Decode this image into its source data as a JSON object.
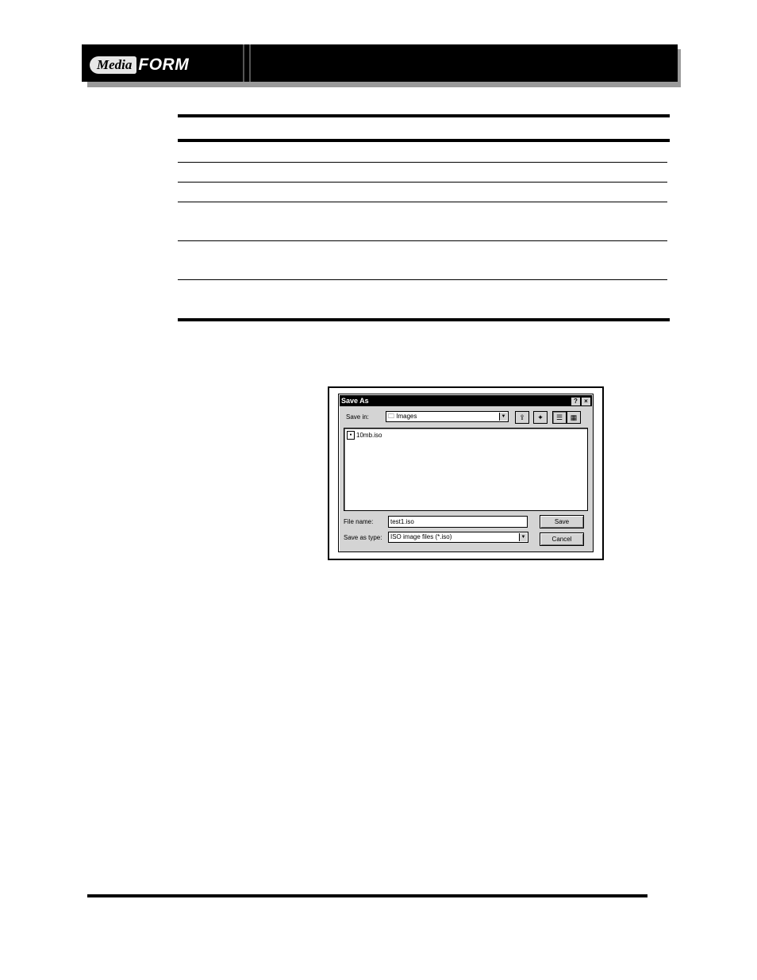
{
  "header": {
    "logo_prefix": "Media",
    "logo_word": "FORM"
  },
  "dialog": {
    "title": "Save As",
    "help_button": "?",
    "close_button": "×",
    "save_in_label": "Save in:",
    "save_in_value": "Images",
    "files": [
      {
        "name": "10mb.iso"
      }
    ],
    "file_name_label": "File name:",
    "file_name_value": "test1.iso",
    "save_as_type_label": "Save as type:",
    "save_as_type_value": "ISO image files (*.iso)",
    "save_button": "Save",
    "cancel_button": "Cancel"
  }
}
